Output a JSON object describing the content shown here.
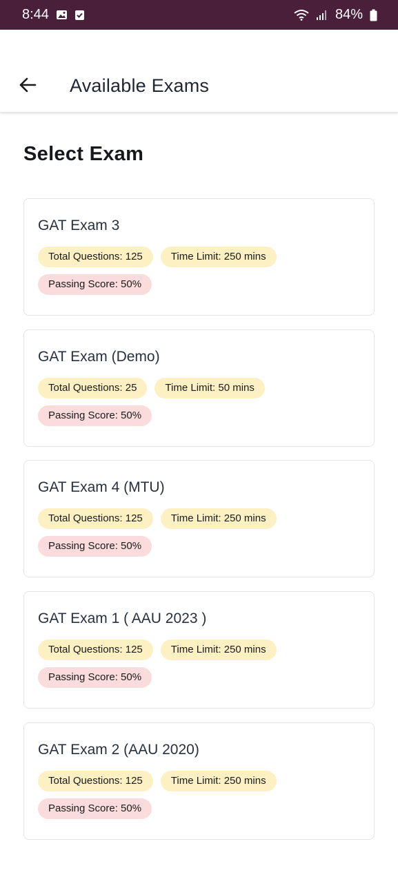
{
  "status_bar": {
    "time": "8:44",
    "battery": "84%",
    "icons": [
      "image-icon",
      "checkbox-icon",
      "wifi-icon",
      "signal-icon",
      "battery-icon"
    ]
  },
  "app_bar": {
    "title": "Available Exams",
    "back_icon": "arrow-left-icon"
  },
  "page": {
    "heading": "Select Exam"
  },
  "exams": [
    {
      "title": "GAT Exam 3",
      "questions": "Total Questions: 125",
      "time_limit": "Time Limit: 250 mins",
      "passing": "Passing Score: 50%"
    },
    {
      "title": "GAT Exam (Demo)",
      "questions": "Total Questions: 25",
      "time_limit": "Time Limit: 50 mins",
      "passing": "Passing Score: 50%"
    },
    {
      "title": "GAT Exam 4 (MTU)",
      "questions": "Total Questions: 125",
      "time_limit": "Time Limit: 250 mins",
      "passing": "Passing Score: 50%"
    },
    {
      "title": "GAT Exam 1 ( AAU 2023 )",
      "questions": "Total Questions: 125",
      "time_limit": "Time Limit: 250 mins",
      "passing": "Passing Score: 50%"
    },
    {
      "title": "GAT Exam 2 (AAU 2020)",
      "questions": "Total Questions: 125",
      "time_limit": "Time Limit: 250 mins",
      "passing": "Passing Score: 50%"
    }
  ],
  "colors": {
    "status_bar": "#4a1f3a",
    "chip_info": "#fdf1c4",
    "chip_passing": "#fbdcdc",
    "title_text": "#27303f"
  }
}
